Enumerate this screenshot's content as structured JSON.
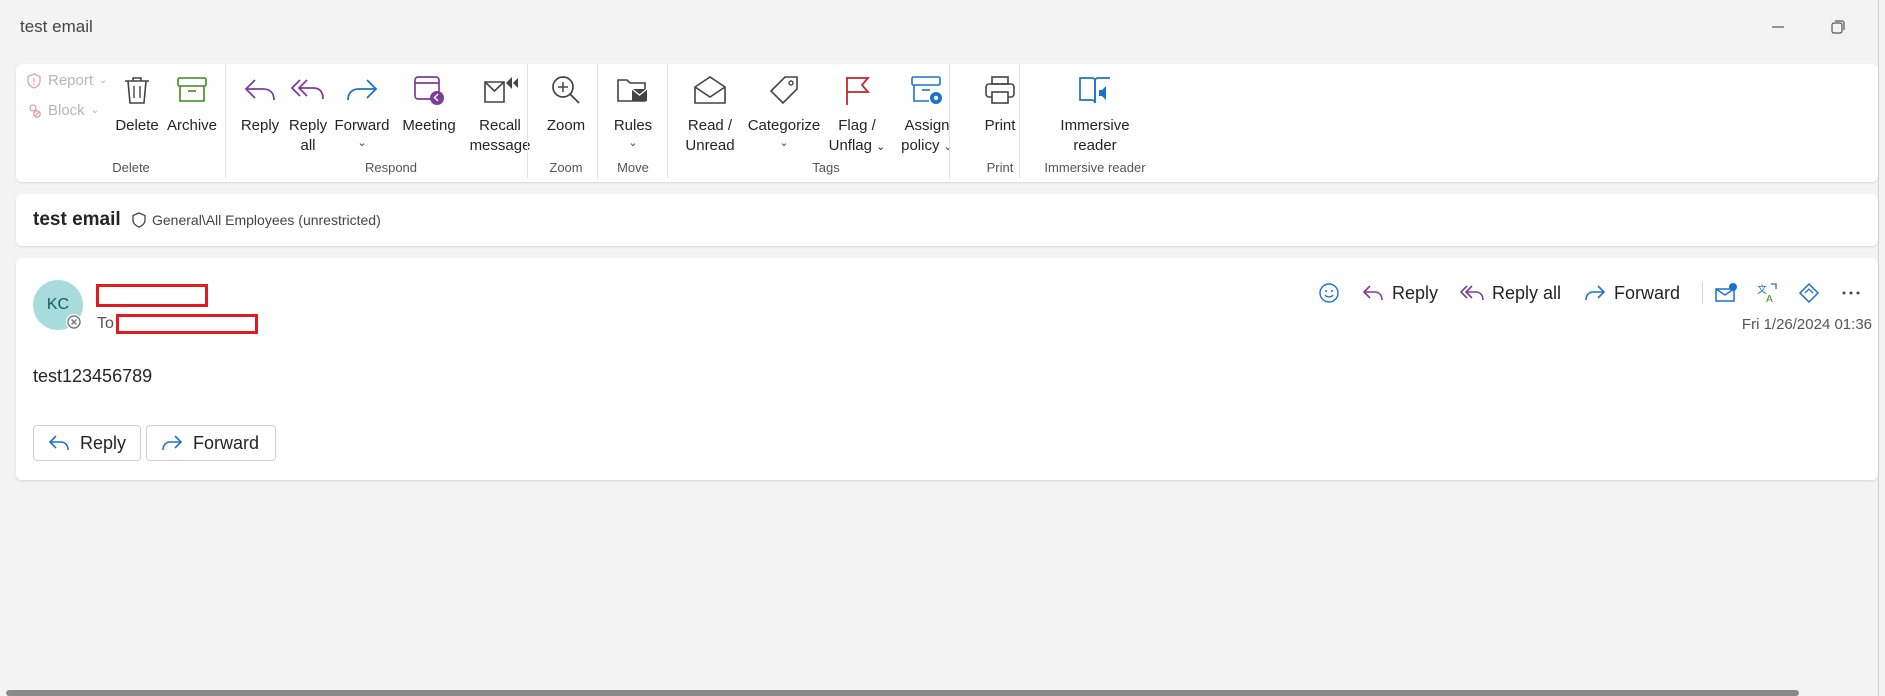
{
  "window": {
    "title": "test email"
  },
  "ribbon": {
    "report_label": "Report",
    "block_label": "Block",
    "groups": {
      "delete": "Delete",
      "respond": "Respond",
      "zoom": "Zoom",
      "move": "Move",
      "tags": "Tags",
      "print": "Print",
      "immersive": "Immersive reader"
    },
    "buttons": {
      "delete": "Delete",
      "archive": "Archive",
      "reply_l1": "Reply",
      "reply_all_l1": "Reply",
      "reply_all_l2": "all",
      "forward": "Forward",
      "meeting": "Meeting",
      "recall_l1": "Recall",
      "recall_l2": "message",
      "zoom": "Zoom",
      "rules": "Rules",
      "read_l1": "Read /",
      "read_l2": "Unread",
      "categorize": "Categorize",
      "flag_l1": "Flag /",
      "flag_l2": "Unflag",
      "assign_l1": "Assign",
      "assign_l2": "policy",
      "print": "Print",
      "immersive_l1": "Immersive",
      "immersive_l2": "reader"
    }
  },
  "subject": {
    "title": "test email",
    "sensitivity": "General\\All Employees (unrestricted)"
  },
  "message": {
    "avatar_initials": "KC",
    "to_label": "To",
    "actions": {
      "reply": "Reply",
      "reply_all": "Reply all",
      "forward": "Forward"
    },
    "timestamp": "Fri 1/26/2024 01:36",
    "body": "test123456789",
    "bottom_reply": "Reply",
    "bottom_forward": "Forward"
  }
}
